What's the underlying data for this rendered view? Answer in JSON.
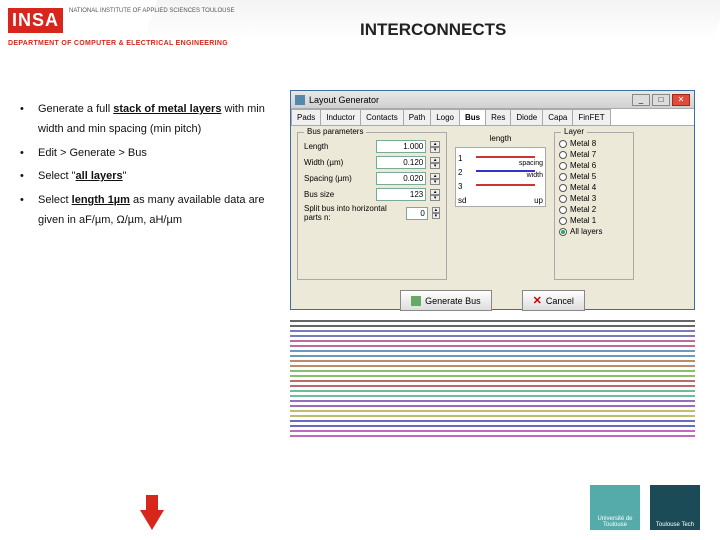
{
  "logo": {
    "insa": "INSA",
    "sub": "NATIONAL INSTITUTE\nOF APPLIED\nSCIENCES\nTOULOUSE"
  },
  "dept": "DEPARTMENT OF COMPUTER & ELECTRICAL ENGINEERING",
  "title": "INTERCONNECTS",
  "bullets": {
    "b0": {
      "p0": "Generate a full ",
      "p1": "stack of metal layers",
      "p2": " with min width and min spacing (min pitch)"
    },
    "b1": "Edit > Generate > Bus",
    "b2": {
      "p0": "Select \"",
      "p1": "all layers",
      "p2": "\""
    },
    "b3": {
      "p0": "Select ",
      "p1": "length 1µm",
      "p2": " as many available data are given in aF/µm, Ω/µm, aH/µm"
    }
  },
  "window": {
    "title": "Layout Generator",
    "tabs": [
      "Pads",
      "Inductor",
      "Contacts",
      "Path",
      "Logo",
      "Bus",
      "Res",
      "Diode",
      "Capa",
      "FinFET"
    ],
    "active_tab": 5,
    "group_label": "Bus parameters",
    "params": {
      "length": {
        "label": "Length",
        "value": "1.000"
      },
      "width": {
        "label": "Width (µm)",
        "value": "0.120"
      },
      "spacing": {
        "label": "Spacing (µm)",
        "value": "0.020"
      },
      "bussize": {
        "label": "Bus size",
        "value": "123"
      }
    },
    "split": {
      "label": "Split bus into horizontal parts n:",
      "value": "0"
    },
    "preview": {
      "length_lbl": "length",
      "spacing_lbl": "spacing",
      "width_lbl": "width",
      "n1": "1",
      "n2": "2",
      "n3": "3",
      "sd": "sd",
      "up": "up"
    },
    "layer_label": "Layer",
    "layers": [
      {
        "label": "Metal 8",
        "checked": false
      },
      {
        "label": "Metal 7",
        "checked": false
      },
      {
        "label": "Metal 6",
        "checked": false
      },
      {
        "label": "Metal 5",
        "checked": false
      },
      {
        "label": "Metal 4",
        "checked": false
      },
      {
        "label": "Metal 3",
        "checked": false
      },
      {
        "label": "Metal 2",
        "checked": false
      },
      {
        "label": "Metal 1",
        "checked": false
      },
      {
        "label": "All layers",
        "checked": true
      }
    ],
    "buttons": {
      "generate": "Generate Bus",
      "cancel": "Cancel"
    }
  },
  "footer": {
    "l1": "Université de Toulouse",
    "l2": "Toulouse Tech"
  }
}
